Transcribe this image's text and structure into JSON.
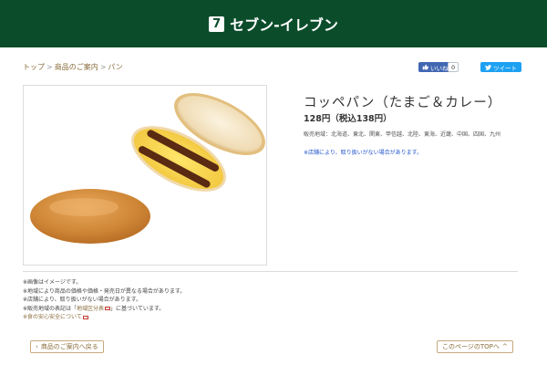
{
  "header": {
    "logo_mark": "7",
    "brand": "セブン-イレブン",
    "bg_color": "#0b4d2b"
  },
  "breadcrumb": {
    "items": [
      "トップ",
      "商品のご案内",
      "パン"
    ],
    "separator": ">"
  },
  "social": {
    "like_label": "いいね！",
    "like_count": "0",
    "tweet_label": "ツイート",
    "like_icon": "thumbs-up-icon",
    "tweet_icon": "bird-icon"
  },
  "product": {
    "title": "コッペパン（たまご＆カレー）",
    "price": "128円（税込138円）",
    "region": "販売地域：北海道、東北、関東、甲信越、北陸、東海、近畿、中国、四国、九州",
    "region_note": "※店舗により、取り扱いがない場合があります。"
  },
  "notes": {
    "lines": [
      "※画像はイメージです。",
      "※地域により商品の価格や価格・発売日が異なる場合があります。",
      "※店舗により、取り扱いがない場合があります。"
    ],
    "area_prefix": "※販売地域の表記は「",
    "area_link": "地域区分表",
    "area_suffix": "」に基づいています。",
    "safety_link": "※食の安心安全について"
  },
  "footer_nav": {
    "back_label": "商品のご案内へ戻る",
    "top_label": "このページのTOPへ"
  }
}
